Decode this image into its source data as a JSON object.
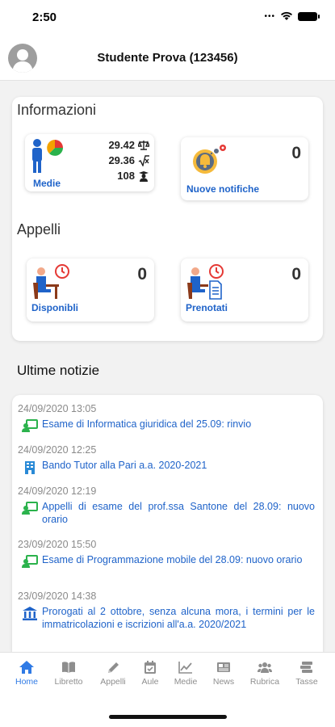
{
  "status_bar": {
    "time": "2:50",
    "icons": [
      "signal-dots-icon",
      "wifi-icon",
      "battery-icon"
    ]
  },
  "header": {
    "title": "Studente Prova (123456)",
    "avatar_icon": "user-silhouette-icon"
  },
  "informazioni": {
    "title": "Informazioni",
    "medie": {
      "label": "Medie",
      "stats": [
        {
          "value": "29.42",
          "icon": "scales-icon"
        },
        {
          "value": "29.36",
          "icon": "square-root-icon"
        },
        {
          "value": "108",
          "icon": "graduate-icon"
        }
      ]
    },
    "notifiche": {
      "label": "Nuove notifiche",
      "count": "0"
    }
  },
  "appelli": {
    "title": "Appelli",
    "disponibili": {
      "label": "Disponibli",
      "count": "0"
    },
    "prenotati": {
      "label": "Prenotati",
      "count": "0"
    }
  },
  "news": {
    "title": "Ultime notizie",
    "items": [
      {
        "date": "24/09/2020 13:05",
        "text": "Esame di Informatica giuridica del 25.09: rinvio",
        "icon": "teacher-board-icon"
      },
      {
        "date": "24/09/2020 12:25",
        "text": "Bando Tutor alla Pari a.a. 2020-2021",
        "icon": "building-icon"
      },
      {
        "date": "24/09/2020 12:19",
        "text": "Appelli di esame del prof.ssa Santone del 28.09: nuovo orario",
        "icon": "teacher-board-icon"
      },
      {
        "date": "23/09/2020 15:50",
        "text": "Esame di Programmazione mobile del 28.09: nuovo orario",
        "icon": "teacher-board-icon"
      },
      {
        "date": "23/09/2020 14:38",
        "text": "Prorogati al 2 ottobre, senza alcuna mora, i termini per le immatricolazioni e iscrizioni all'a.a. 2020/2021",
        "icon": "institution-icon"
      }
    ]
  },
  "tabbar": {
    "active": "Home",
    "colors": {
      "active": "#2f7ae5",
      "inactive": "#8e8e8e"
    },
    "tabs": [
      {
        "label": "Home",
        "icon": "home-icon"
      },
      {
        "label": "Libretto",
        "icon": "book-icon"
      },
      {
        "label": "Appelli",
        "icon": "pencil-icon"
      },
      {
        "label": "Aule",
        "icon": "calendar-icon"
      },
      {
        "label": "Medie",
        "icon": "chart-icon"
      },
      {
        "label": "News",
        "icon": "newspaper-icon"
      },
      {
        "label": "Rubrica",
        "icon": "people-icon"
      },
      {
        "label": "Tasse",
        "icon": "money-icon"
      }
    ]
  },
  "colors": {
    "accent": "#1f63c9",
    "news_icon_green": "#2bb24c",
    "alarm_red": "#e53935"
  }
}
